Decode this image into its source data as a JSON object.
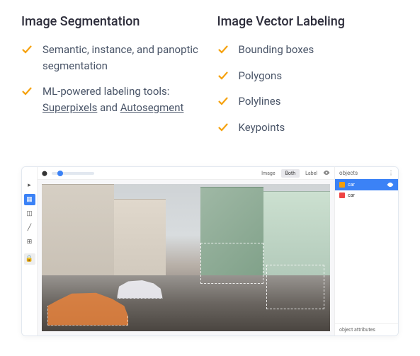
{
  "columns": {
    "left": {
      "title": "Image Segmentation",
      "items": [
        {
          "prefix": "Semantic, instance, and panoptic segmentation",
          "link1": "",
          "mid": "",
          "link2": ""
        },
        {
          "prefix": "ML-powered labeling tools: ",
          "link1": "Superpixels",
          "mid": " and ",
          "link2": "Autosegment"
        }
      ]
    },
    "right": {
      "title": "Image Vector Labeling",
      "items": [
        {
          "text": "Bounding boxes"
        },
        {
          "text": "Polygons"
        },
        {
          "text": "Polylines"
        },
        {
          "text": "Keypoints"
        }
      ]
    }
  },
  "editor": {
    "tabs": {
      "image": "Image",
      "both": "Both",
      "label": "Label"
    },
    "panel_title": "objects",
    "objects": [
      {
        "name": "car",
        "color": "#f59e0b",
        "selected": true
      },
      {
        "name": "car",
        "color": "#ef4444",
        "selected": false
      }
    ],
    "attrs_label": "object attributes"
  }
}
